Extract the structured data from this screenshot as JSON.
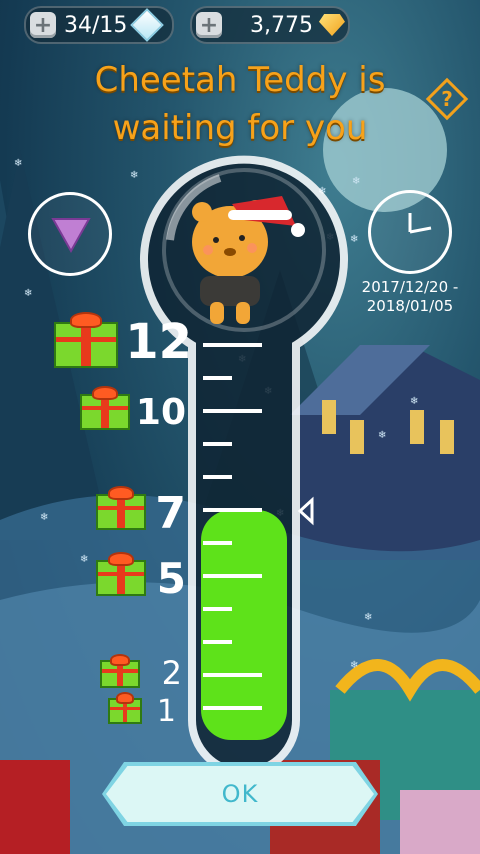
{
  "currency": {
    "ice": {
      "value": "34/15",
      "icon": "ice-cube-icon"
    },
    "gems": {
      "value": "3,775",
      "icon": "gem-icon"
    }
  },
  "title": {
    "line1": "Cheetah Teddy is",
    "line2": "waiting for you"
  },
  "help_label": "?",
  "event_dates": {
    "line1": "2017/12/20 -",
    "line2": "2018/01/05"
  },
  "thermometer": {
    "current_level": 7,
    "max_level": 12,
    "milestones": [
      {
        "label": "12",
        "gift": "large"
      },
      {
        "label": "10",
        "gift": "medium"
      },
      {
        "label": "7",
        "gift": "medium"
      },
      {
        "label": "5",
        "gift": "medium"
      },
      {
        "label": "2",
        "gift": "small"
      },
      {
        "label": "1",
        "gift": "small"
      }
    ],
    "fill_color": "#5ee21a"
  },
  "ok_label": "OK",
  "colors": {
    "title": "#f7a21a",
    "ok_text": "#41b8cc"
  }
}
